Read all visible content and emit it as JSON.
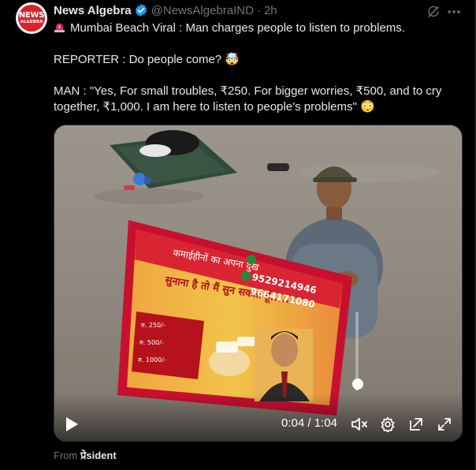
{
  "post": {
    "avatar_text_line1": "NEWS",
    "avatar_text_line2": "ALGEBRA",
    "author_name": "News Algebra",
    "handle": "@NewsAlgebraIND",
    "separator": "·",
    "timestamp": "2h",
    "text_line1": "Mumbai Beach Viral : Man charges people to listen to problems.",
    "text_line2": "REPORTER : Do people come? 🤯",
    "text_line3": "MAN : \"Yes, For small troubles, ₹250. For bigger worries, ₹500, and to cry together, ₹1,000. I am here to listen to people’s problems\" 😳",
    "source_prefix": "From",
    "source_name": "प्रेsident"
  },
  "video": {
    "current_time": "0:04",
    "time_separator": "/",
    "duration": "1:04",
    "volume_fraction": 0.08,
    "state": "paused",
    "sign": {
      "line_top": "कमाईहीनों का अपना दुख",
      "line_main": "सुनाना है तो मैं सुन सकता हूँ......",
      "phone1": "9529214946",
      "phone2": "9664171080",
      "fee1": "रु. 250/-",
      "fee2": "रु. 500/-",
      "fee3": "रु. 1000/-"
    }
  },
  "icons": {
    "verified": "verified-badge-icon",
    "grok": "grok-icon",
    "more": "more-icon",
    "siren": "siren-icon",
    "play": "play-icon",
    "mute": "volume-muted-icon",
    "settings": "settings-icon",
    "pip": "picture-in-picture-icon",
    "fullscreen": "fullscreen-icon"
  },
  "colors": {
    "background": "#000000",
    "text": "#e7e9ea",
    "secondary": "#71767b",
    "verified": "#1d9bf0",
    "avatar_red": "#d8232a"
  }
}
